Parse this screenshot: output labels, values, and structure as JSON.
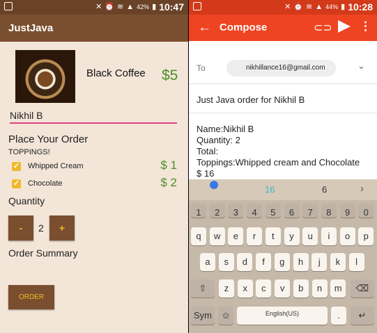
{
  "left_status": {
    "battery": "42%",
    "time": "10:47"
  },
  "right_status": {
    "battery": "44%",
    "time": "10:28"
  },
  "app": {
    "title": "JustJava"
  },
  "product": {
    "name": "Black Coffee",
    "price": "$5"
  },
  "name_input": {
    "value": "Nikhil B"
  },
  "order": {
    "heading": "Place Your Order",
    "toppings_heading": "TOPPINGS!",
    "toppings": [
      {
        "label": "Whipped Cream",
        "price": "$ 1",
        "checked": true
      },
      {
        "label": "Chocolate",
        "price": "$ 2",
        "checked": true
      }
    ],
    "quantity_label": "Quantity",
    "decrement": "-",
    "increment": "+",
    "quantity": "2",
    "summary_label": "Order Summary",
    "order_button": "ORDER"
  },
  "compose": {
    "title": "Compose",
    "to_label": "To",
    "to_address": "nikhillance16@gmail.com",
    "subject": "Just Java order for Nikhil B",
    "body_lines": [
      "Name:Nikhil B",
      "Quantity: 2",
      "Total:",
      "Toppings:Whipped cream and Chocolate",
      "$ 16"
    ]
  },
  "keyboard": {
    "suggestions": [
      "16",
      "6"
    ],
    "number_row": [
      "1",
      "2",
      "3",
      "4",
      "5",
      "6",
      "7",
      "8",
      "9",
      "0"
    ],
    "row1": [
      "q",
      "w",
      "e",
      "r",
      "t",
      "y",
      "u",
      "i",
      "o",
      "p"
    ],
    "row2": [
      "a",
      "s",
      "d",
      "f",
      "g",
      "h",
      "j",
      "k",
      "l"
    ],
    "row3": [
      "z",
      "x",
      "c",
      "v",
      "b",
      "n",
      "m"
    ],
    "sym": "Sym",
    "space_label": "English(US)",
    "period": "."
  },
  "colors": {
    "brown": "#7a4f2f",
    "accent_gold": "#f0b92c",
    "price_green": "#4e8e2a",
    "gmail_red": "#ef4422"
  },
  "icons": [
    "gallery-icon",
    "alarm-icon",
    "wifi-icon",
    "signal-icon",
    "battery-icon",
    "back-arrow-icon",
    "attach-icon",
    "send-icon",
    "more-vert-icon",
    "chevron-down-icon",
    "shift-icon",
    "backspace-icon",
    "emoji-icon",
    "enter-icon",
    "checkmark-icon"
  ]
}
